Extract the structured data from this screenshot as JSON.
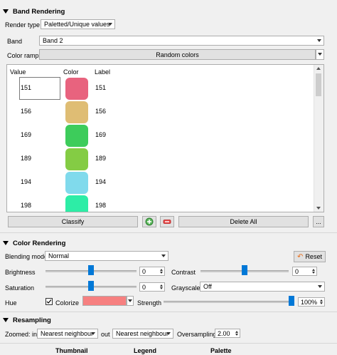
{
  "band_rendering": {
    "section_title": "Band Rendering",
    "render_type_label": "Render type",
    "render_type_value": "Paletted/Unique values",
    "band_label": "Band",
    "band_value": "Band 2",
    "color_ramp_label": "Color ramp",
    "color_ramp_value": "Random colors",
    "columns": {
      "value": "Value",
      "color": "Color",
      "label": "Label"
    },
    "rows": [
      {
        "value": "151",
        "label": "151",
        "color": "#e8637e"
      },
      {
        "value": "156",
        "label": "156",
        "color": "#dfbd74"
      },
      {
        "value": "169",
        "label": "169",
        "color": "#3dcc5b"
      },
      {
        "value": "189",
        "label": "189",
        "color": "#84cc44"
      },
      {
        "value": "194",
        "label": "194",
        "color": "#80daec"
      },
      {
        "value": "198",
        "label": "198",
        "color": "#2deda6"
      }
    ],
    "classify_label": "Classify",
    "add_icon": "plus-icon",
    "remove_icon": "minus-icon",
    "delete_all_label": "Delete All",
    "more_label": "..."
  },
  "color_rendering": {
    "section_title": "Color Rendering",
    "blending_mode_label": "Blending mode",
    "blending_mode_value": "Normal",
    "reset_label": "Reset",
    "brightness_label": "Brightness",
    "brightness_value": "0",
    "contrast_label": "Contrast",
    "contrast_value": "0",
    "saturation_label": "Saturation",
    "saturation_value": "0",
    "grayscale_label": "Grayscale",
    "grayscale_value": "Off",
    "hue_label": "Hue",
    "colorize_label": "Colorize",
    "colorize_checked": true,
    "colorize_color": "#f68080",
    "strength_label": "Strength",
    "strength_value": "100%"
  },
  "resampling": {
    "section_title": "Resampling",
    "zoomed_in_label": "Zoomed: in",
    "zoomed_in_value": "Nearest neighbour",
    "out_label": "out",
    "out_value": "Nearest neighbour",
    "oversampling_label": "Oversampling",
    "oversampling_value": "2.00"
  },
  "footer_headers": [
    "Thumbnail",
    "Legend",
    "Palette"
  ]
}
